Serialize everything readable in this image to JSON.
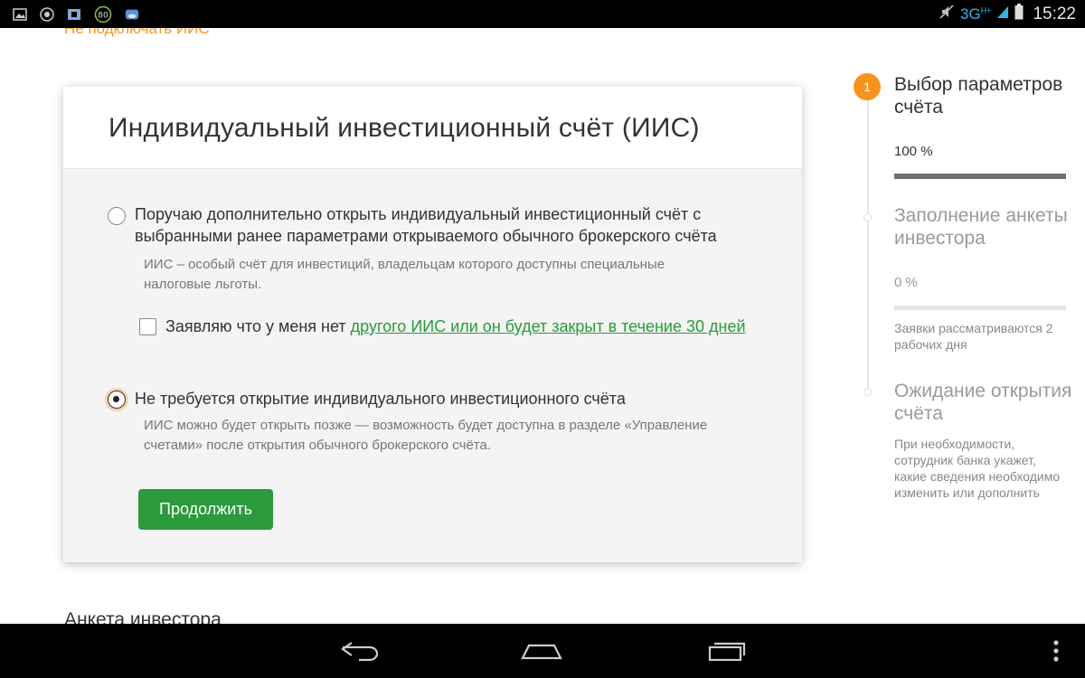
{
  "status_bar": {
    "left_icons": [
      "gallery-icon",
      "chrome-icon",
      "app-icon",
      "battery-80-icon",
      "weather-icon"
    ],
    "badge": "80",
    "network": "3G",
    "network_sup": "H+",
    "time": "15:22"
  },
  "top_link": "Не подключать ИИС",
  "card": {
    "title": "Индивидуальный инвестиционный счёт (ИИС)",
    "option1": {
      "label": "Поручаю дополнительно открыть индивидуальный инвестиционный счёт с выбранными ранее параметрами открываемого обычного брокерского счёта",
      "hint": "ИИС – особый счёт для инвестиций, владельцам которого доступны специальные налоговые льготы.",
      "selected": false
    },
    "checkbox": {
      "label_prefix": "Заявляю что у меня нет ",
      "link_text": "другого ИИС или он будет закрыт в течение 30 дней",
      "checked": false
    },
    "option2": {
      "label": "Не требуется открытие индивидуального инвестиционного счёта",
      "hint": "ИИС можно будет открыть позже — возможность будет доступна в разделе «Управление счетами» после открытия обычного брокерского счёта.",
      "selected": true
    },
    "continue_label": "Продолжить"
  },
  "bottom_heading": "Анкета инвестора",
  "steps": [
    {
      "number": "1",
      "title": "Выбор параметров счёта",
      "percent": "100 %",
      "progress": 1.0,
      "note": ""
    },
    {
      "number": "",
      "title": "Заполнение анкеты инвестора",
      "percent": "0 %",
      "progress": 0.0,
      "note": "Заявки рассматриваются 2 рабочих дня"
    },
    {
      "number": "",
      "title": "Ожидание открытия счёта",
      "percent": "",
      "progress": null,
      "note": "При необходимости, сотрудник банка укажет, какие сведения необходимо изменить или дополнить"
    }
  ],
  "nav_bar": [
    "back-icon",
    "home-icon",
    "recents-icon",
    "menu-icon"
  ],
  "colors": {
    "accent_green": "#2a9a3b",
    "accent_orange": "#f7941d",
    "card_bg": "#f4f4f4"
  }
}
